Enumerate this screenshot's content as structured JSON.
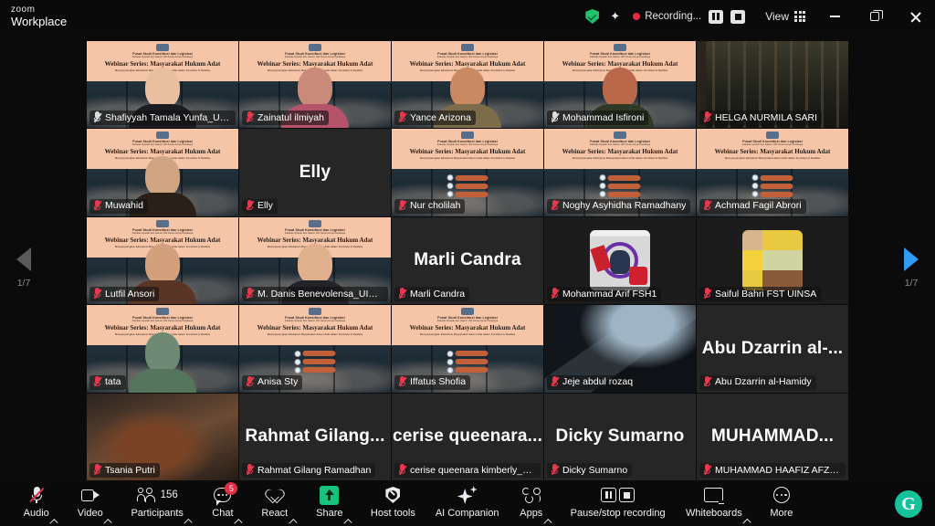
{
  "titlebar": {
    "brand_line1": "zoom",
    "brand_line2": "Workplace",
    "encryption_icon": "shield-check-icon",
    "ai_icon": "sparkle-icon",
    "recording_label": "Recording...",
    "pause_recording_icon": "pause-icon",
    "stop_recording_icon": "stop-icon",
    "view_label": "View",
    "view_icon": "grid-icon",
    "minimize_icon": "minimize-icon",
    "maximize_icon": "restore-icon",
    "close_icon": "close-icon"
  },
  "banner": {
    "org_line": "Pusat Studi Konstitusi dan Legislasi",
    "org_sub": "Fakultas Syariah dan Hukum UIN Sunan Ampel Surabaya",
    "title": "Webinar Series: Masyarakat Hukum Adat",
    "subtitle": "Memperjuangkan Eksistensi Masyarakat Hukum Adat dalam Konstitusi & Realitas"
  },
  "pager": {
    "prev_icon": "chevron-left-icon",
    "next_icon": "chevron-right-icon",
    "prev_label": "1/7",
    "next_label": "1/7",
    "prev_enabled": false,
    "next_enabled": true
  },
  "gallery": {
    "active_speaker": "Shafiyyah Tamala Yunfa_UINSA",
    "tiles": [
      {
        "name": "Shafiyyah Tamala Yunfa_UINSA",
        "kind": "vbg-person",
        "muted": false,
        "active": true,
        "big": null,
        "skin": "#e8bfa0",
        "cloth": "#1b1b22"
      },
      {
        "name": "Zainatul ilmiyah",
        "kind": "vbg-person",
        "muted": true,
        "active": false,
        "big": null,
        "skin": "#c98a7a",
        "cloth": "#b5536a"
      },
      {
        "name": "Yance Arizona",
        "kind": "vbg-person",
        "muted": true,
        "active": false,
        "big": null,
        "skin": "#c98a63",
        "cloth": "#7d6c4a"
      },
      {
        "name": "Mohammad Isfironi",
        "kind": "vbg-person",
        "muted": false,
        "active": false,
        "big": null,
        "skin": "#b9694a",
        "cloth": "#2e3a26"
      },
      {
        "name": "HELGA NURMILA SARI",
        "kind": "forest",
        "muted": true,
        "active": false,
        "big": null
      },
      {
        "name": "Muwahid",
        "kind": "vbg-person",
        "muted": true,
        "active": false,
        "big": null,
        "skin": "#cfa481",
        "cloth": "#2a2018"
      },
      {
        "name": "Elly",
        "kind": "bigname",
        "muted": true,
        "active": false,
        "big": "Elly"
      },
      {
        "name": "Nur cholilah",
        "kind": "vbg-badges",
        "muted": true,
        "active": false,
        "big": null
      },
      {
        "name": "Noghy Asyhidha Ramadhany",
        "kind": "vbg-badges",
        "muted": true,
        "active": false,
        "big": null
      },
      {
        "name": "Achmad Fagil Abrori",
        "kind": "vbg-badges",
        "muted": true,
        "active": false,
        "big": null
      },
      {
        "name": "Lutfil Ansori",
        "kind": "vbg-person",
        "muted": true,
        "active": false,
        "big": null,
        "skin": "#d3a07c",
        "cloth": "#5a3525"
      },
      {
        "name": "M. Danis Benevolensa_UINSA",
        "kind": "vbg-person",
        "muted": true,
        "active": false,
        "big": null,
        "skin": "#e0b08c",
        "cloth": "#22242a"
      },
      {
        "name": "Marli Candra",
        "kind": "bigname",
        "muted": true,
        "active": false,
        "big": "Marli Candra"
      },
      {
        "name": "Mohammad Arif FSH1",
        "kind": "avatar-flag",
        "muted": true,
        "active": false,
        "big": null
      },
      {
        "name": "Saiful Bahri FST UINSA",
        "kind": "avatar-kid",
        "muted": true,
        "active": false,
        "big": null
      },
      {
        "name": "tata",
        "kind": "vbg-person",
        "muted": true,
        "active": false,
        "big": null,
        "skin": "#6f8a74",
        "cloth": "#55765c"
      },
      {
        "name": "Anisa Sty",
        "kind": "vbg-badges",
        "muted": true,
        "active": false,
        "big": null
      },
      {
        "name": "Iffatus Shofia",
        "kind": "vbg-badges",
        "muted": true,
        "active": false,
        "big": null
      },
      {
        "name": "Jeje abdul rozaq",
        "kind": "car",
        "muted": true,
        "active": false,
        "big": null
      },
      {
        "name": "Abu Dzarrin al-Hamidy",
        "kind": "bigname",
        "muted": true,
        "active": false,
        "big": "Abu Dzarrin al-..."
      },
      {
        "name": "Tsania Putri",
        "kind": "guitar",
        "muted": true,
        "active": false,
        "big": null
      },
      {
        "name": "Rahmat Gilang Ramadhan",
        "kind": "bigname",
        "muted": true,
        "active": false,
        "big": "Rahmat Gilang..."
      },
      {
        "name": "cerise queenara kimberly_uinsa",
        "kind": "bigname",
        "muted": true,
        "active": false,
        "big": "cerise queenara..."
      },
      {
        "name": "Dicky Sumarno",
        "kind": "bigname",
        "muted": true,
        "active": false,
        "big": "Dicky Sumarno"
      },
      {
        "name": "MUHAMMAD HAAFIZ AFZAAL ...",
        "kind": "bigname",
        "muted": true,
        "active": false,
        "big": "MUHAMMAD..."
      }
    ]
  },
  "toolbar": {
    "items": [
      {
        "label": "Audio",
        "icon": "microphone-muted-icon",
        "caret": true,
        "count": null,
        "badge": null
      },
      {
        "label": "Video",
        "icon": "camera-icon",
        "caret": true,
        "count": null,
        "badge": null
      },
      {
        "label": "Participants",
        "icon": "people-icon",
        "caret": true,
        "count": "156",
        "badge": null
      },
      {
        "label": "Chat",
        "icon": "chat-bubble-icon",
        "caret": true,
        "count": null,
        "badge": "5"
      },
      {
        "label": "React",
        "icon": "heart-icon",
        "caret": true,
        "count": null,
        "badge": null
      },
      {
        "label": "Share",
        "icon": "share-screen-icon",
        "caret": true,
        "count": null,
        "badge": null
      },
      {
        "label": "Host tools",
        "icon": "shield-host-icon",
        "caret": false,
        "count": null,
        "badge": null
      },
      {
        "label": "AI Companion",
        "icon": "ai-sparkle-icon",
        "caret": false,
        "count": null,
        "badge": null
      },
      {
        "label": "Apps",
        "icon": "apps-icon",
        "caret": true,
        "count": null,
        "badge": null
      },
      {
        "label": "Pause/stop recording",
        "icon": "pause-stop-recording-icon",
        "caret": false,
        "count": null,
        "badge": null
      },
      {
        "label": "Whiteboards",
        "icon": "whiteboard-icon",
        "caret": true,
        "count": null,
        "badge": null
      },
      {
        "label": "More",
        "icon": "more-ellipsis-icon",
        "caret": false,
        "count": null,
        "badge": null
      }
    ],
    "grammarly_icon": "grammarly-g-icon",
    "grammarly_letter": "G",
    "accent_green": "#19c37d",
    "accent_red": "#e02f44",
    "accent_blue": "#2f9bf5"
  }
}
